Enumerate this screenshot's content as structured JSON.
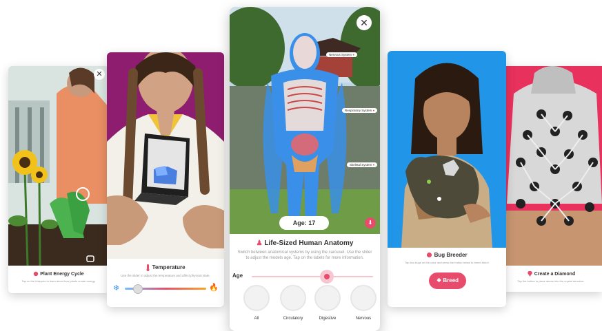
{
  "cards": {
    "plant": {
      "title": "Plant Energy Cycle",
      "desc": "Tap on the hotspots to learn about how plants create energy."
    },
    "temperature": {
      "title": "Temperature",
      "desc": "Use the slider to adjust the temperature and affect physical state.",
      "level": 0.15
    },
    "anatomy": {
      "title": "Life-Sized Human Anatomy",
      "desc": "Switch between anatomical systems by using the carousel. Use the slider to adjust the models age. Tap on the labels for more information.",
      "age_badge": "Age: 17",
      "age_label": "Age",
      "age_level": 0.62,
      "hotspots": [
        "Nervous System",
        "Respiratory System",
        "Skeletal System"
      ],
      "systems": [
        "All",
        "Circulatory",
        "Digestive",
        "Nervous"
      ]
    },
    "bug": {
      "title": "Bug Breeder",
      "desc": "Tap two bugs on the color and press the button below to breed them!",
      "button": "Breed"
    },
    "diamond": {
      "title": "Create a Diamond",
      "desc": "Tap the button to place atoms into the crystal structure."
    }
  },
  "colors": {
    "accent": "#e84c6c",
    "ar_blue": "#3a8fe8"
  }
}
